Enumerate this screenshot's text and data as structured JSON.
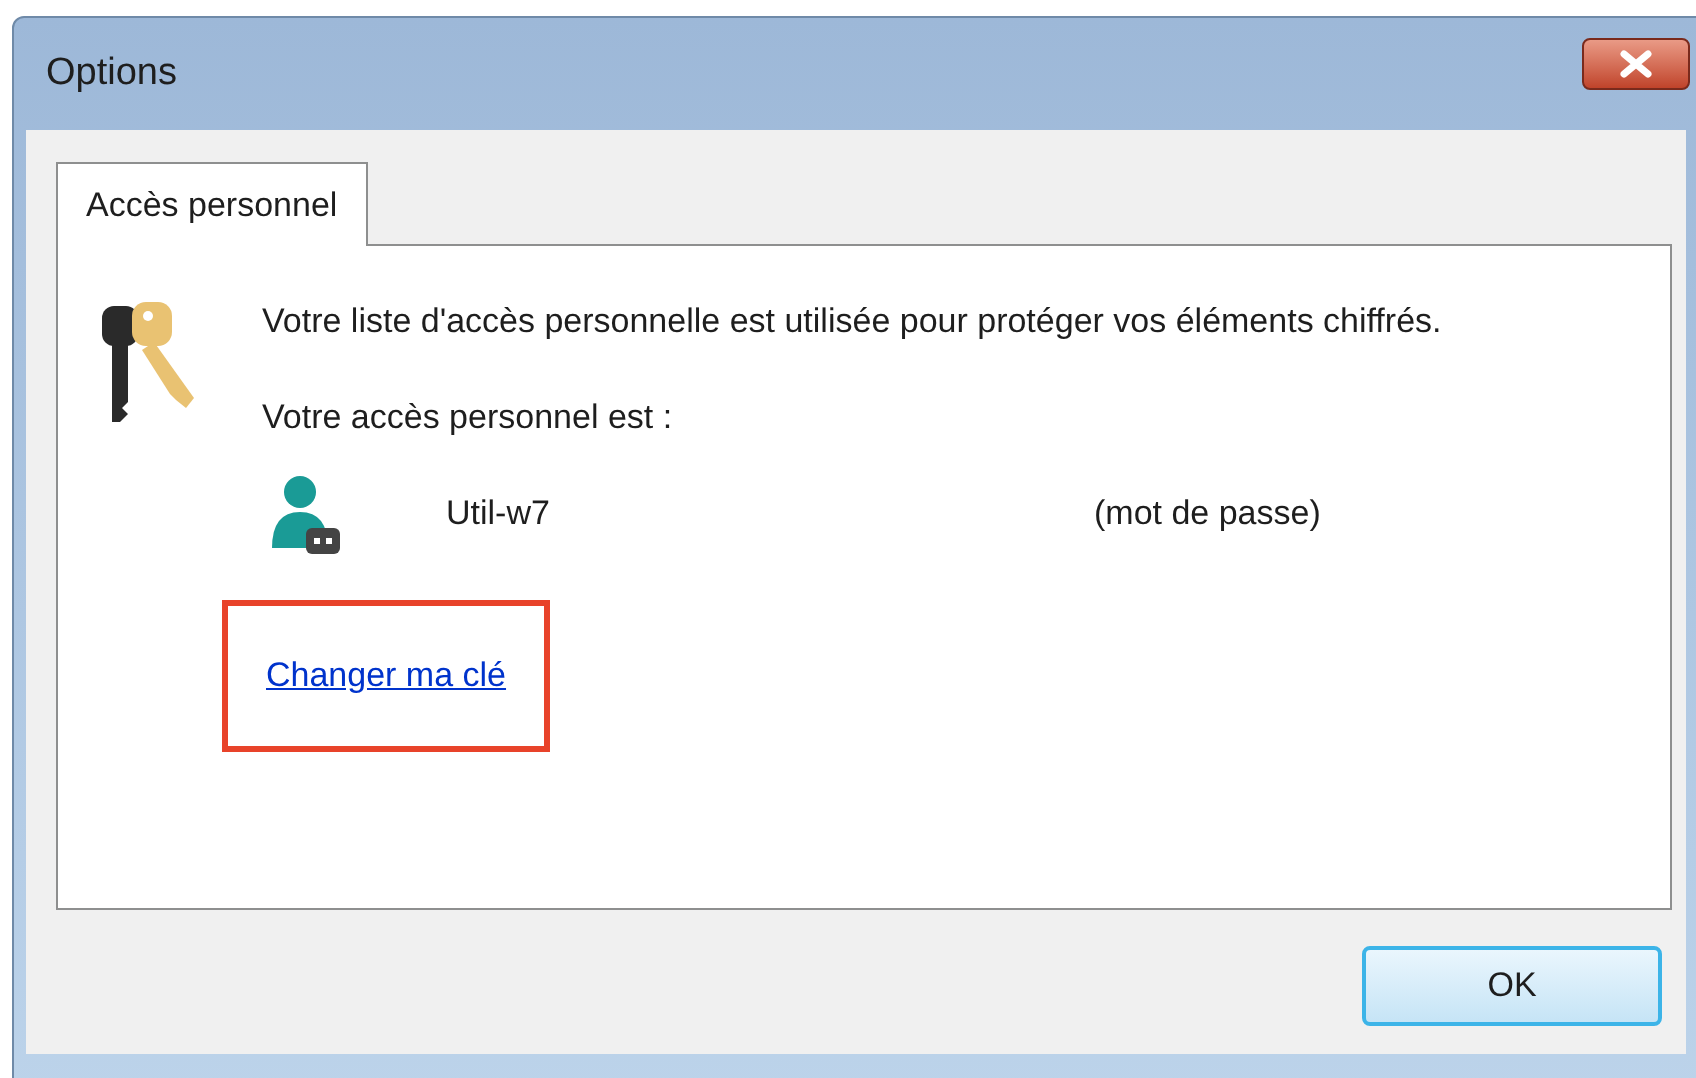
{
  "window": {
    "title": "Options"
  },
  "tabs": [
    {
      "label": "Accès personnel",
      "selected": true
    }
  ],
  "description": "Votre liste d'accès personnelle est utilisée pour protéger vos éléments chiffrés.",
  "access_label": "Votre accès personnel est :",
  "account": {
    "name": "Util-w7",
    "type": "(mot de passe)"
  },
  "change_key_link": {
    "label": "Changer ma clé",
    "highlighted": true
  },
  "buttons": [
    "OK"
  ]
}
